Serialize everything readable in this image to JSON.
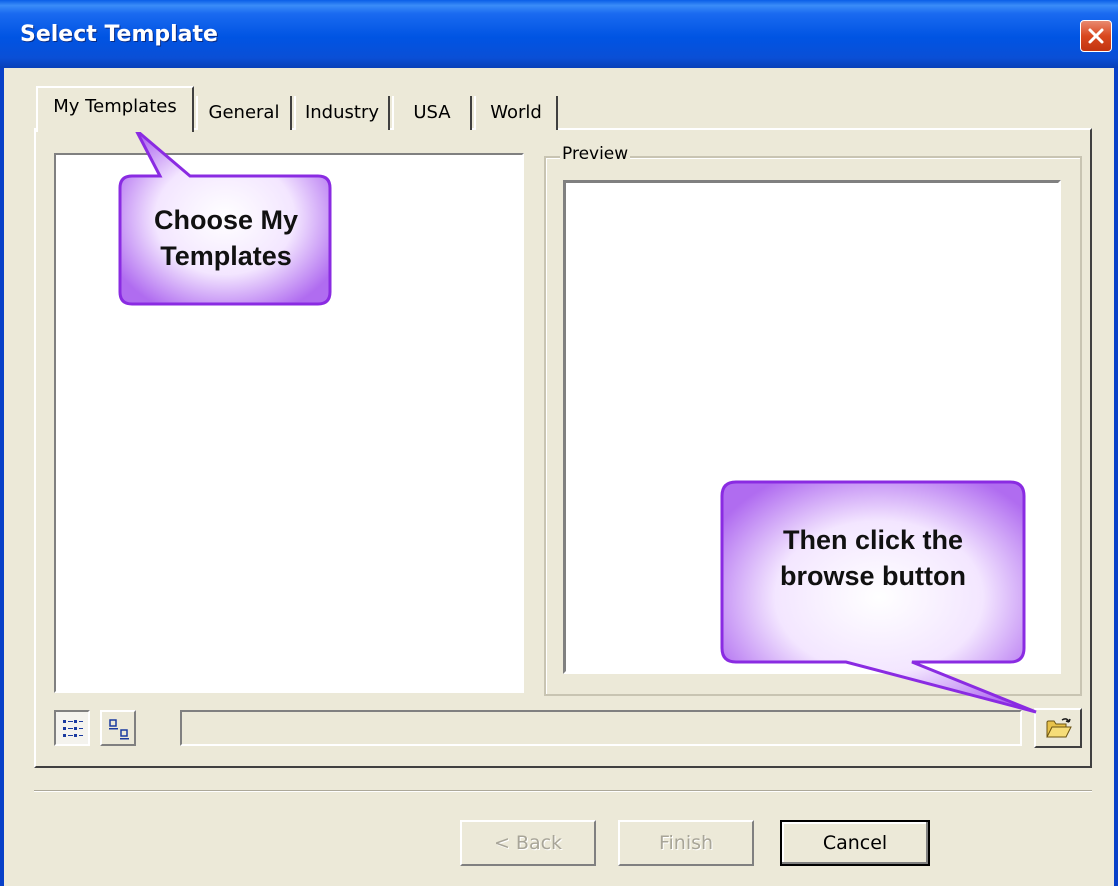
{
  "window": {
    "title": "Select Template"
  },
  "tabs": [
    {
      "label": "My Templates",
      "active": true
    },
    {
      "label": "General",
      "active": false
    },
    {
      "label": "Industry",
      "active": false
    },
    {
      "label": "USA",
      "active": false
    },
    {
      "label": "World",
      "active": false
    }
  ],
  "preview": {
    "label": "Preview"
  },
  "path_field": {
    "value": ""
  },
  "buttons": {
    "back": "< Back",
    "finish": "Finish",
    "cancel": "Cancel"
  },
  "callouts": {
    "tab_hint": {
      "line1": "Choose My",
      "line2": "Templates"
    },
    "browse_hint": {
      "line1": "Then click the",
      "line2": "browse button"
    }
  },
  "colors": {
    "titlebar": "#0054e3",
    "dialog_bg": "#ece9d8",
    "callout_fill": "#b06cf0",
    "callout_border": "#8a2be2",
    "close_button": "#d9481f"
  },
  "icons": {
    "close": "close-icon",
    "view_list": "list-view-icon",
    "view_thumbnails": "thumbnail-view-icon",
    "browse": "open-folder-icon"
  }
}
